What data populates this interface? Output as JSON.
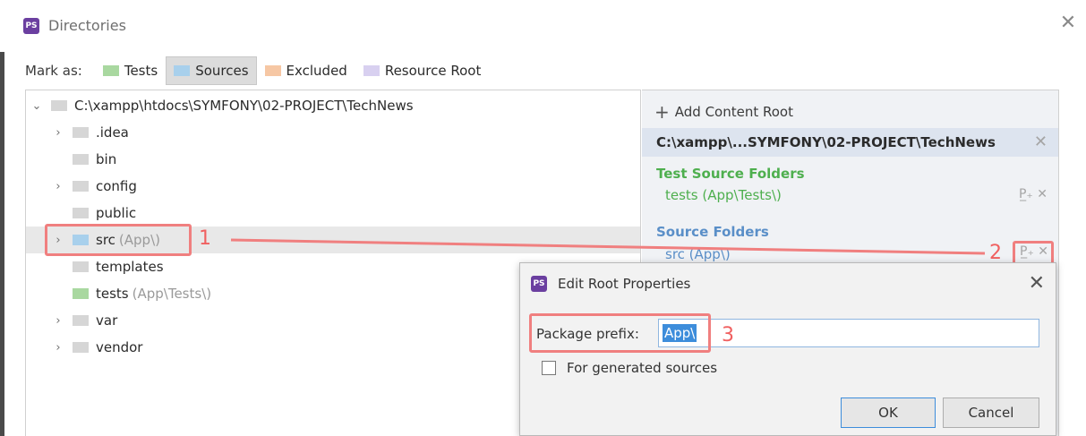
{
  "window": {
    "title": "Directories",
    "close_glyph": "✕"
  },
  "markbar": {
    "label": "Mark as:",
    "buttons": [
      {
        "text": "Tests",
        "mnemonic": "T",
        "color": "#a9d8a0"
      },
      {
        "text": "Sources",
        "mnemonic": "S",
        "color": "#a8d0ec"
      },
      {
        "text": "Excluded",
        "mnemonic": "E",
        "color": "#f6c7a4"
      },
      {
        "text": "Resource Root",
        "mnemonic": "R",
        "color": "#d8d0f0"
      }
    ],
    "active_index": 1
  },
  "tree": {
    "rows": [
      {
        "arrow": "⌄",
        "name": "C:\\xampp\\htdocs\\SYMFONY\\02-PROJECT\\TechNews",
        "pkg": "",
        "type": "root"
      },
      {
        "arrow": "›",
        "name": ".idea",
        "pkg": "",
        "type": "plain"
      },
      {
        "arrow": "",
        "name": "bin",
        "pkg": "",
        "type": "plain"
      },
      {
        "arrow": "›",
        "name": "config",
        "pkg": "",
        "type": "plain"
      },
      {
        "arrow": "",
        "name": "public",
        "pkg": "",
        "type": "plain"
      },
      {
        "arrow": "›",
        "name": "src",
        "pkg": "(App\\)",
        "type": "source"
      },
      {
        "arrow": "",
        "name": "templates",
        "pkg": "",
        "type": "plain"
      },
      {
        "arrow": "",
        "name": "tests",
        "pkg": "(App\\Tests\\)",
        "type": "test"
      },
      {
        "arrow": "›",
        "name": "var",
        "pkg": "",
        "type": "plain"
      },
      {
        "arrow": "›",
        "name": "vendor",
        "pkg": "",
        "type": "plain"
      }
    ],
    "selected_index": 5
  },
  "content_root": {
    "add_label": "Add Content Root",
    "add_mnemonic": "C",
    "root_path": "C:\\xampp\\...SYMFONY\\02-PROJECT\\TechNews",
    "test_section": "Test Source Folders",
    "test_entry": "tests (App\\Tests\\)",
    "source_section": "Source Folders",
    "source_entry": "src (App\\)",
    "entry_icons": "P̲₊ ✕"
  },
  "callouts": [
    "1",
    "2",
    "3"
  ],
  "dialog": {
    "title": "Edit Root Properties",
    "prefix_label": "Package prefix:",
    "prefix_value": "App\\",
    "checkbox_label": "For generated sources",
    "ok_label": "OK",
    "cancel_label": "Cancel"
  },
  "colors": {
    "callout": "#f07f7f",
    "test_green": "#4eaf4e",
    "source_blue": "#5a8fc8"
  }
}
